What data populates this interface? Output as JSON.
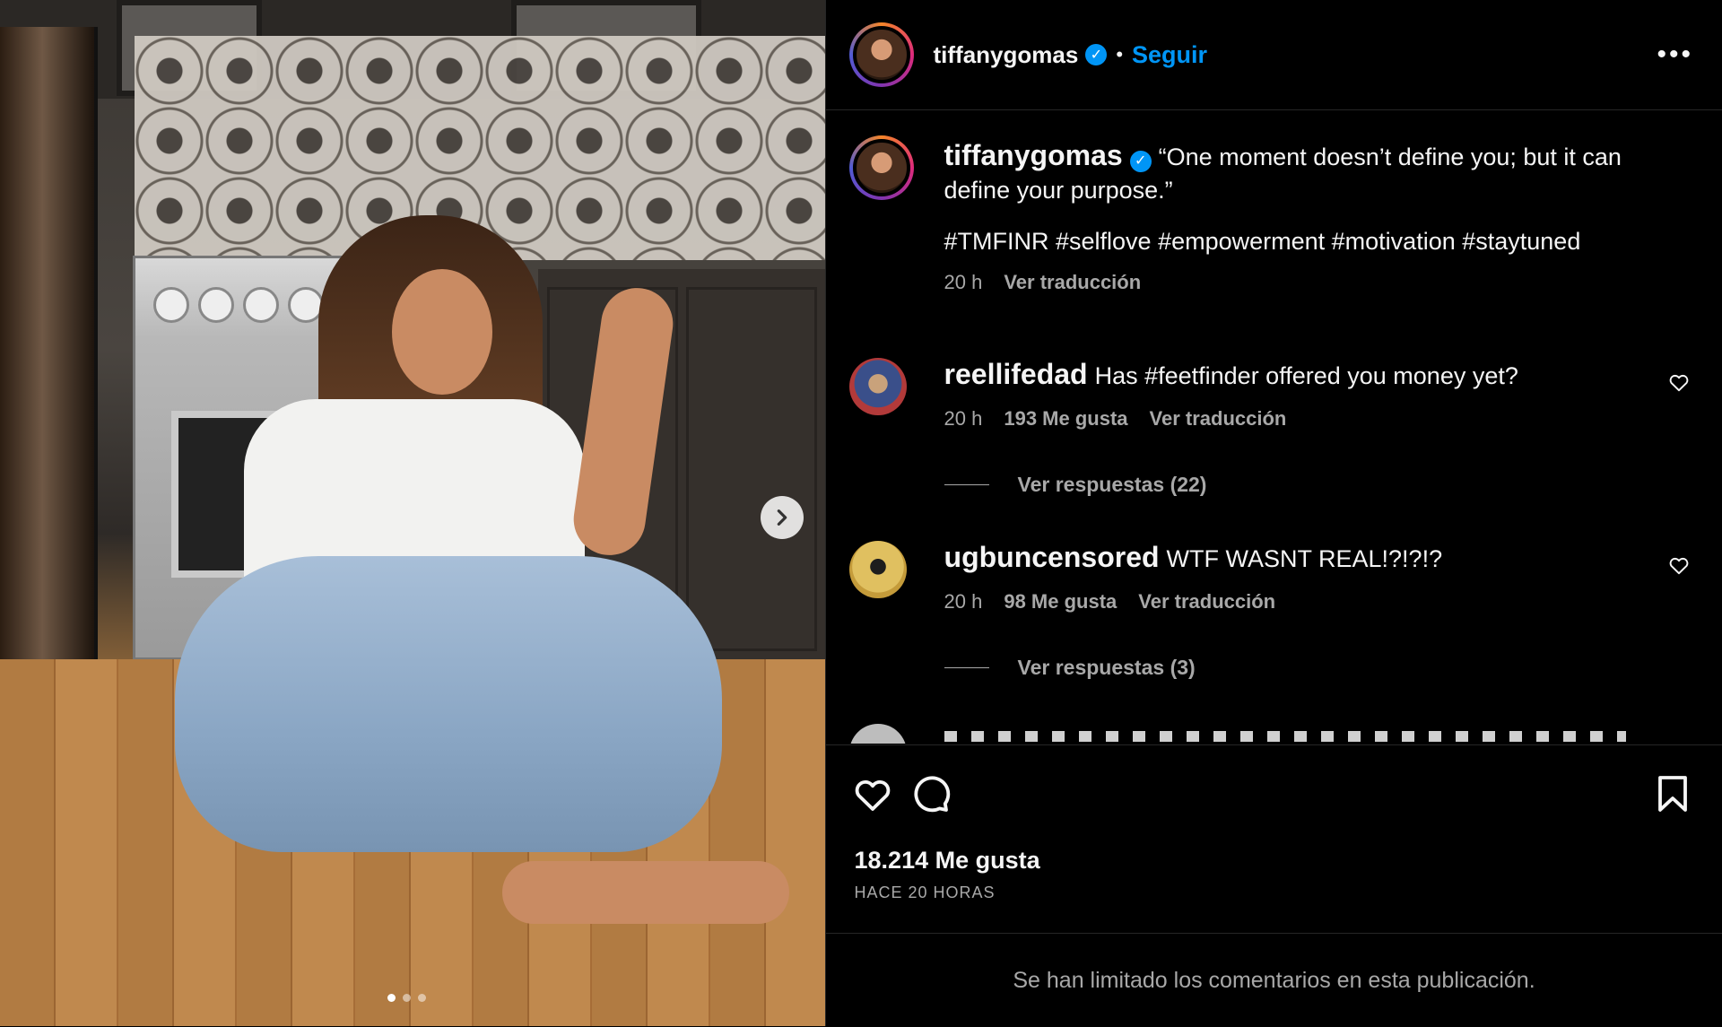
{
  "post": {
    "media": {
      "dots_count": 3,
      "active_dot": 1
    },
    "header": {
      "username": "tiffanygomas",
      "separator": "•",
      "follow_label": "Seguir",
      "more_label": "•••"
    },
    "caption": {
      "username": "tiffanygomas",
      "text": "“One moment doesn’t define you; but it can define your purpose.”",
      "hashtags": "#TMFINR #selflove #empowerment #motivation #staytuned",
      "time": "20 h",
      "translate": "Ver traducción"
    },
    "comments": [
      {
        "username": "reellifedad",
        "text": "Has #feetfinder offered you money yet?",
        "time": "20 h",
        "likes": "193 Me gusta",
        "translate": "Ver traducción",
        "replies": "Ver respuestas (22)"
      },
      {
        "username": "ugbuncensored",
        "text": "WTF WASNT REAL!?!?!?",
        "time": "20 h",
        "likes": "98 Me gusta",
        "translate": "Ver traducción",
        "replies": "Ver respuestas (3)"
      }
    ],
    "likes_count": "18.214 Me gusta",
    "posted_ago": "HACE 20 HORAS",
    "comments_limited": "Se han limitado los comentarios en esta publicación."
  },
  "colors": {
    "background": "#000000",
    "link_blue": "#0095f6",
    "muted_text": "#a8a8a8",
    "divider": "#262626"
  },
  "icons": [
    "chevron-right-icon",
    "verified-icon",
    "more-icon",
    "heart-icon",
    "comment-icon",
    "bookmark-icon"
  ]
}
